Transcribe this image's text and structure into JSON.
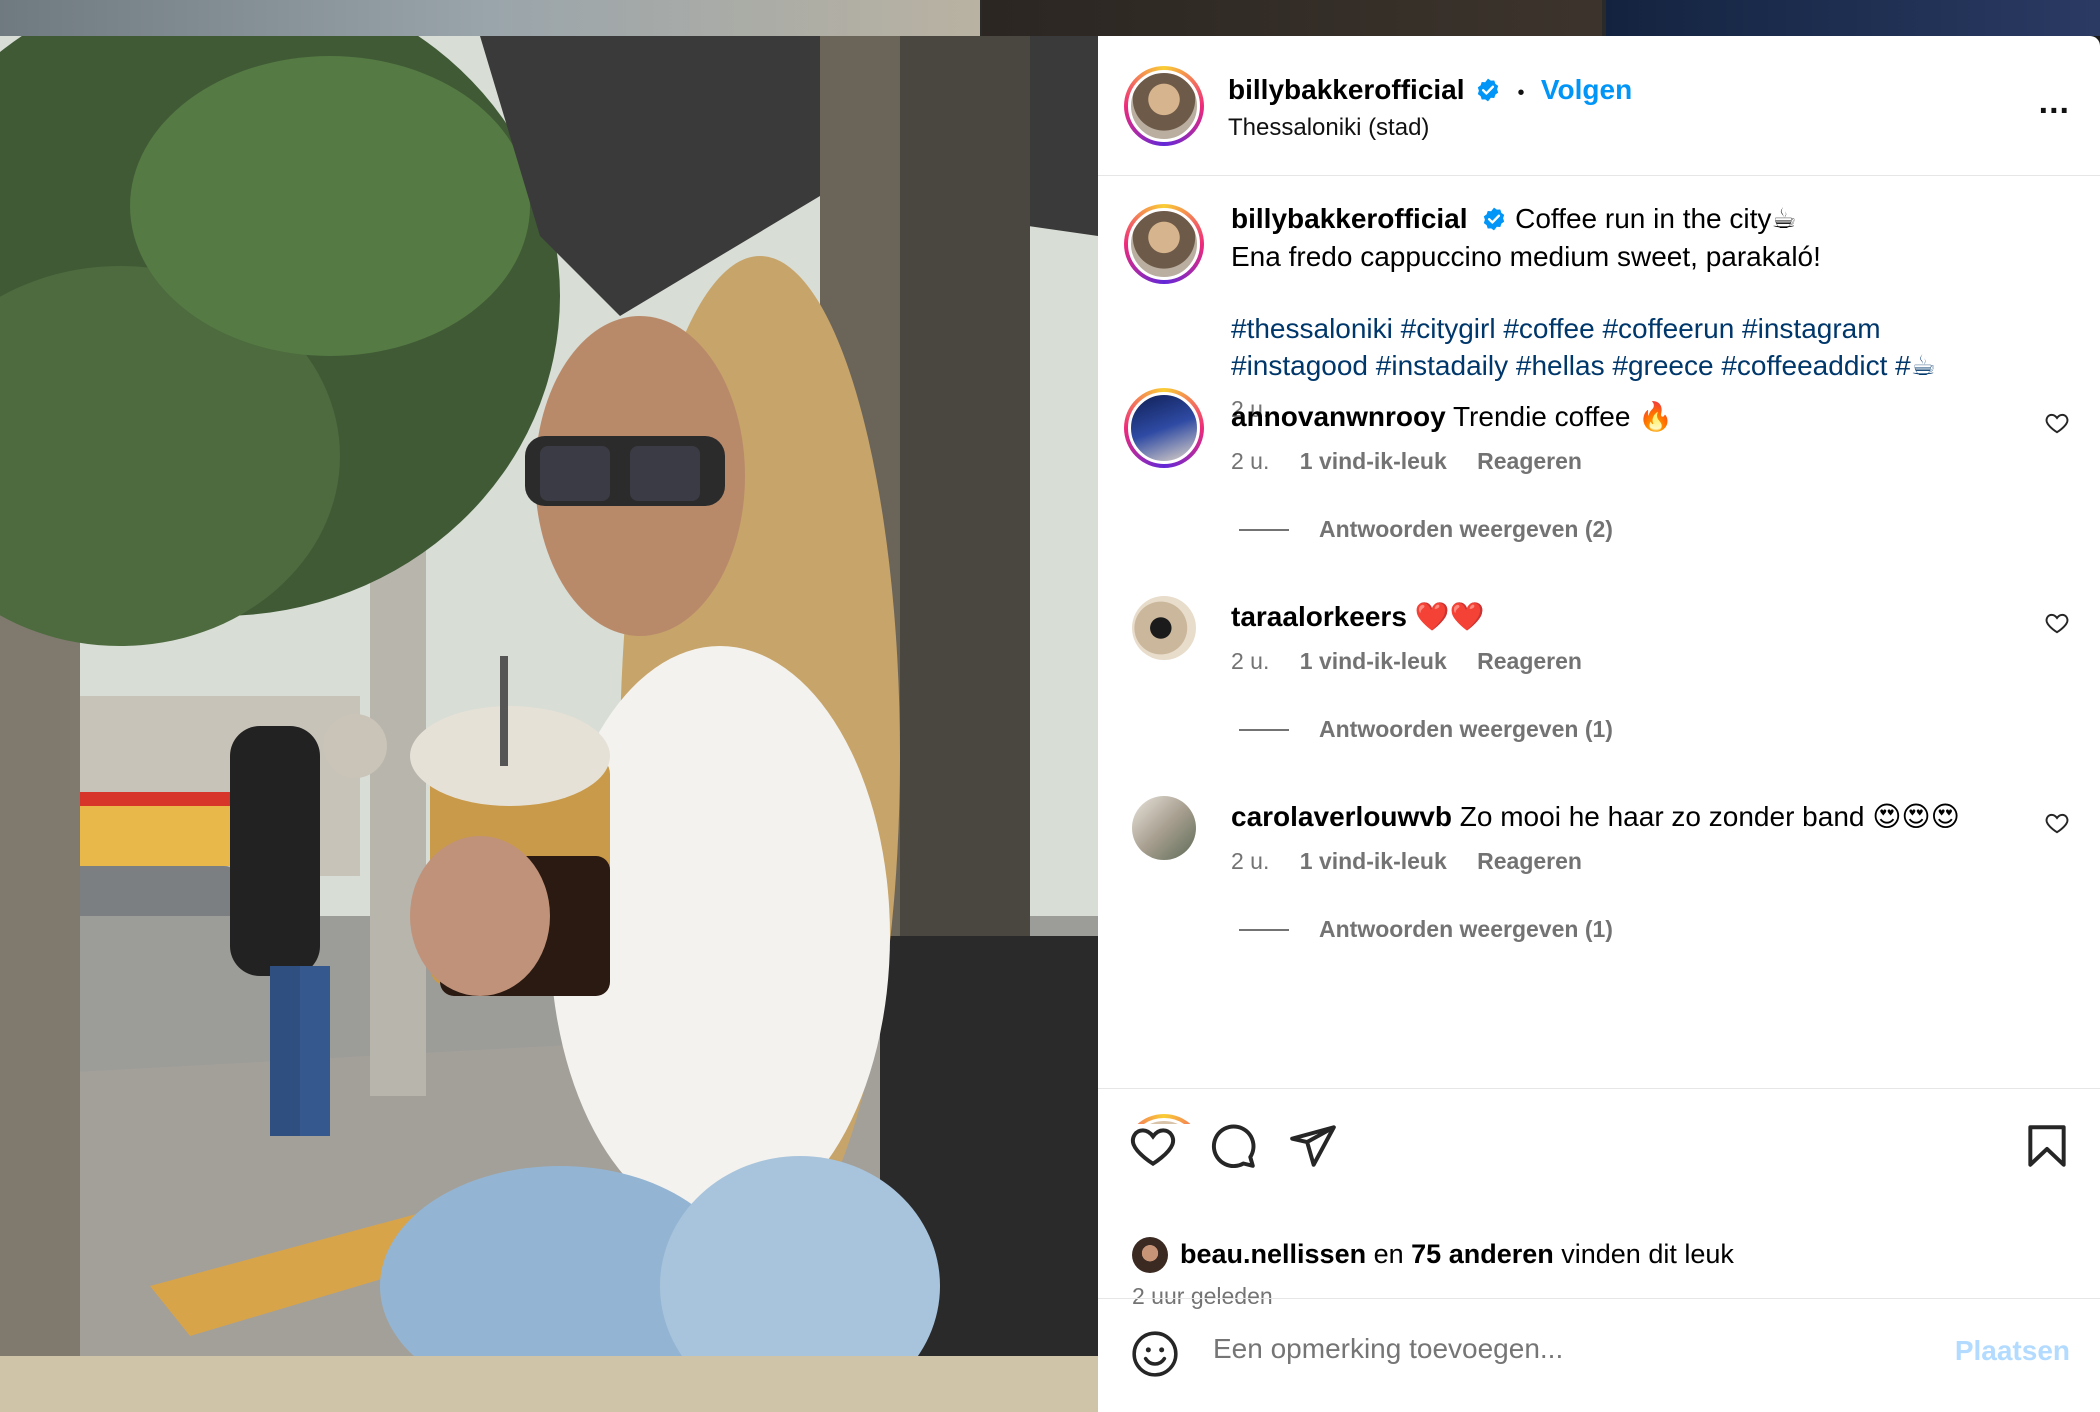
{
  "post": {
    "username": "billybakkerofficial",
    "separator": "•",
    "follow_label": "Volgen",
    "location": "Thessaloniki (stad)",
    "more_label": "...",
    "caption_line1": "Coffee run in the city☕",
    "caption_line2": "Ena fredo cappuccino medium sweet, parakaló!",
    "hashtags_line1": "#thessaloniki #citygirl #coffee #coffeerun #instagram",
    "hashtags_line2": "#instagood #instadaily #hellas #greece #coffeeaddict #☕",
    "time": "2 u."
  },
  "comments": [
    {
      "username": "annovanwnrooy",
      "text": "Trendie coffee 🔥",
      "time": "2 u.",
      "likes": "1 vind-ik-leuk",
      "reply": "Reageren",
      "view_replies": "Antwoorden weergeven (2)"
    },
    {
      "username": "taraalorkeers",
      "text": "❤️❤️",
      "time": "2 u.",
      "likes": "1 vind-ik-leuk",
      "reply": "Reageren",
      "view_replies": "Antwoorden weergeven (1)"
    },
    {
      "username": "carolaverlouwvb",
      "text": "Zo mooi he haar zo zonder band 😍😍😍",
      "time": "2 u.",
      "likes": "1 vind-ik-leuk",
      "reply": "Reageren",
      "view_replies": "Antwoorden weergeven (1)"
    }
  ],
  "likes_summary": {
    "user": "beau.nellissen",
    "conj": "en",
    "others": "75 anderen",
    "suffix": "vinden dit leuk",
    "posted": "2 uur geleden"
  },
  "comment_box": {
    "placeholder": "Een opmerking toevoegen...",
    "post_label": "Plaatsen"
  },
  "icons": [
    "heart-icon",
    "comment-icon",
    "share-icon",
    "bookmark-icon",
    "emoji-icon",
    "verified-icon",
    "more-icon"
  ],
  "colors": {
    "accent": "#0095f6",
    "hashtag": "#00376b",
    "muted": "#737373",
    "post_disabled": "#b3dbff"
  }
}
